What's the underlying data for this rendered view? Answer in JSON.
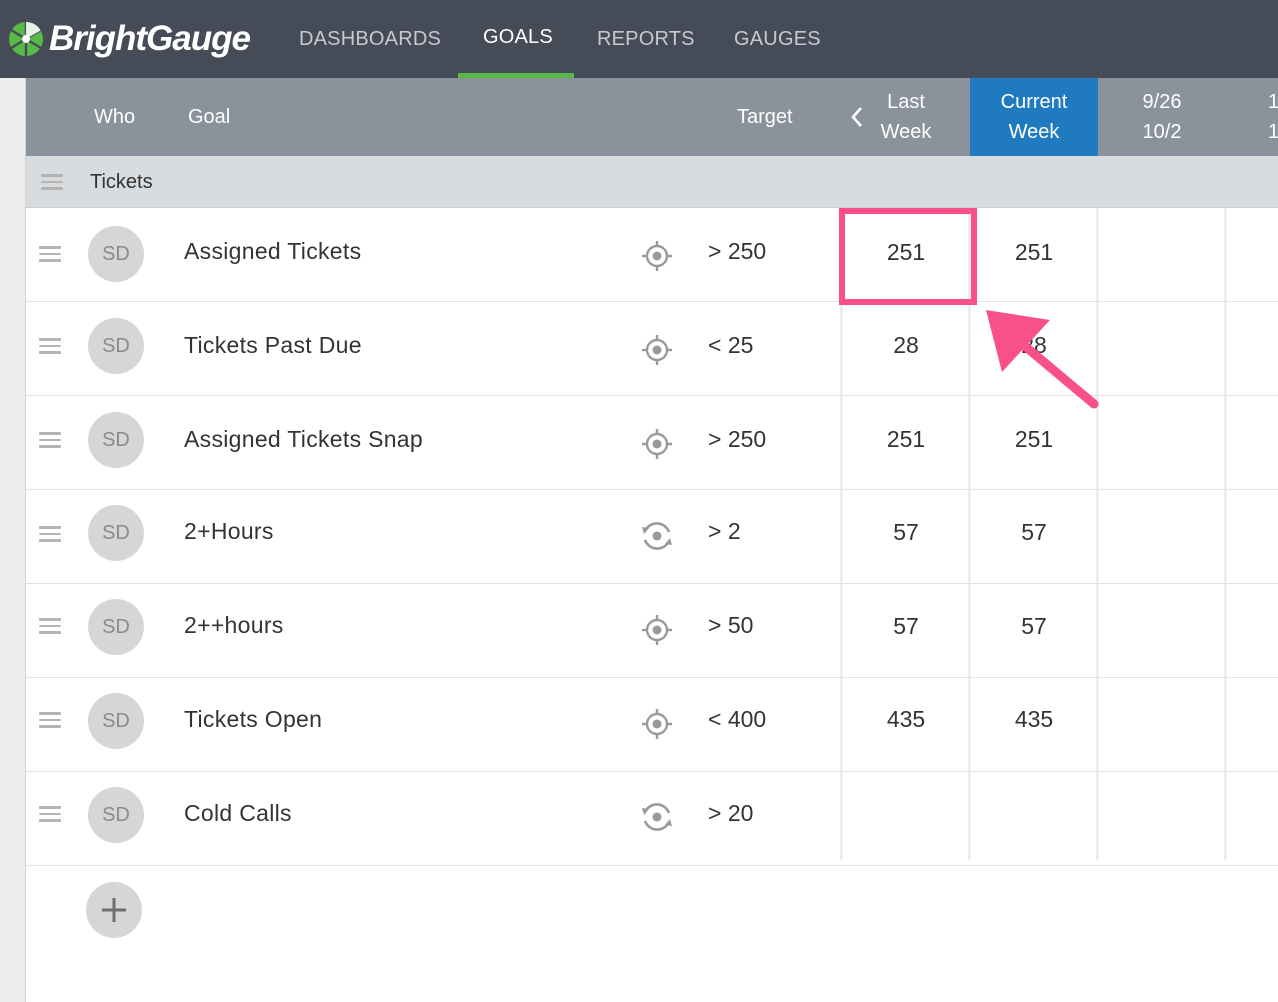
{
  "app": {
    "brand": "BrightGauge",
    "accent_green": "#58b947",
    "topbar_color": "#454c57"
  },
  "nav": {
    "items": [
      {
        "label": "DASHBOARDS"
      },
      {
        "label": "GOALS"
      },
      {
        "label": "REPORTS"
      },
      {
        "label": "GAUGES"
      }
    ],
    "active": "GOALS"
  },
  "table": {
    "headers": {
      "who": "Who",
      "goal": "Goal",
      "target": "Target",
      "last_week_1": "Last",
      "last_week_2": "Week",
      "current_week_1": "Current",
      "current_week_2": "Week",
      "week3_1": "9/26",
      "week3_2": "10/2",
      "week4_1": "1",
      "week4_2": "1"
    },
    "current_week_color": "#1f7abf",
    "section": "Tickets",
    "rows": [
      {
        "who": "SD",
        "goal": "Assigned Tickets",
        "icon": "target-icon",
        "target": "> 250",
        "last_week": "251",
        "current_week": "251"
      },
      {
        "who": "SD",
        "goal": "Tickets Past Due",
        "icon": "target-icon",
        "target": "< 25",
        "last_week": "28",
        "current_week": "28"
      },
      {
        "who": "SD",
        "goal": "Assigned Tickets Snap",
        "icon": "target-icon",
        "target": "> 250",
        "last_week": "251",
        "current_week": "251"
      },
      {
        "who": "SD",
        "goal": "2+Hours",
        "icon": "refresh-target-icon",
        "target": "> 2",
        "last_week": "57",
        "current_week": "57"
      },
      {
        "who": "SD",
        "goal": "2++hours",
        "icon": "target-icon",
        "target": "> 50",
        "last_week": "57",
        "current_week": "57"
      },
      {
        "who": "SD",
        "goal": "Tickets Open",
        "icon": "target-icon",
        "target": "< 400",
        "last_week": "435",
        "current_week": "435"
      },
      {
        "who": "SD",
        "goal": "Cold Calls",
        "icon": "refresh-target-icon",
        "target": "> 20",
        "last_week": "",
        "current_week": ""
      }
    ]
  },
  "annotation": {
    "color": "#f7508a"
  }
}
